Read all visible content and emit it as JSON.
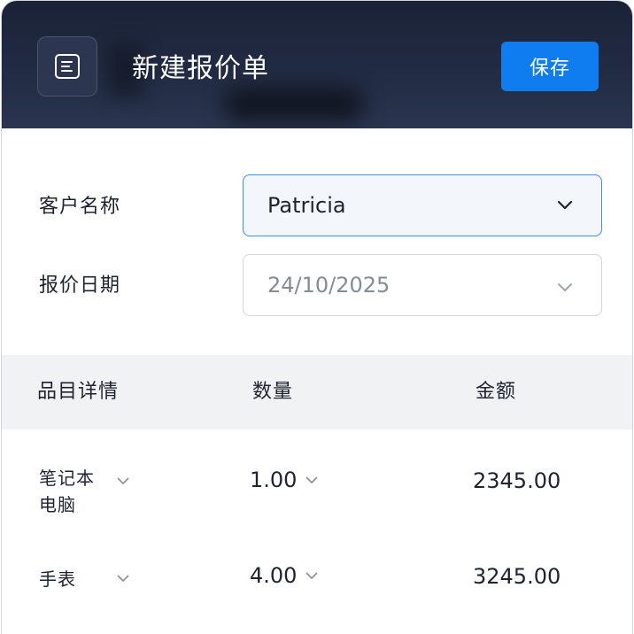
{
  "header": {
    "menu_icon": "document-list-icon",
    "title": "新建报价单",
    "save_label": "保存"
  },
  "form": {
    "customer": {
      "label": "客户名称",
      "value": "Patricia"
    },
    "quote_date": {
      "label": "报价日期",
      "value": "24/10/2025"
    }
  },
  "table": {
    "columns": [
      "品目详情",
      "数量",
      "金额"
    ],
    "rows": [
      {
        "item": "笔记本电脑",
        "quantity": "1.00",
        "amount": "2345.00"
      },
      {
        "item": "手表",
        "quantity": "4.00",
        "amount": "3245.00"
      }
    ]
  },
  "colors": {
    "header_bg": "#1e2740",
    "primary": "#0f7cf0",
    "active_border": "#3d8eed",
    "table_header_bg": "#f1f2f4"
  }
}
